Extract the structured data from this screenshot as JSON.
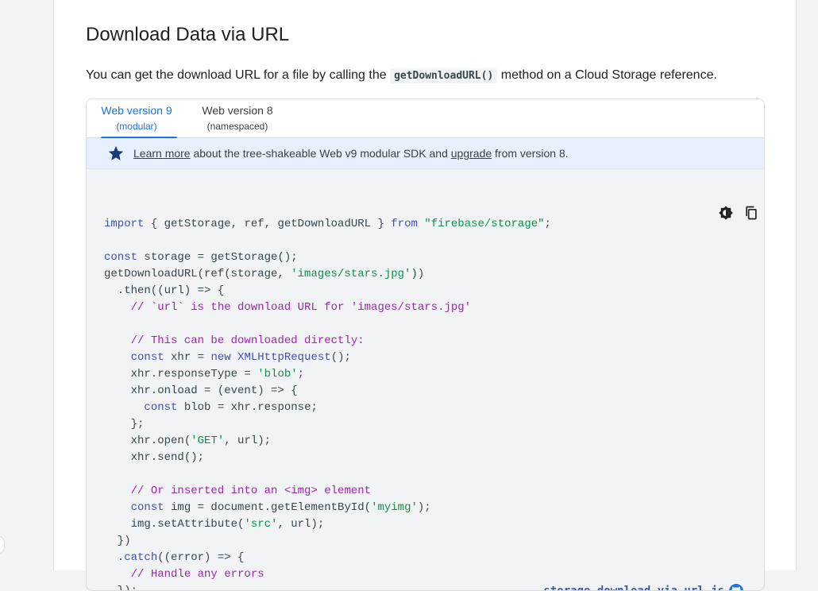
{
  "section": {
    "title": "Download Data via URL",
    "intro_before": "You can get the download URL for a file by calling the ",
    "intro_code": "getDownloadURL()",
    "intro_after": " method on a Cloud Storage reference."
  },
  "tabs": [
    {
      "label": "Web version 9",
      "sublabel": "(modular)",
      "active": true
    },
    {
      "label": "Web version 8",
      "sublabel": "(namespaced)",
      "active": false
    }
  ],
  "notice": {
    "icon": "star-icon",
    "link1": "Learn more",
    "text1": " about the tree-shakeable Web v9 modular SDK and ",
    "link2": "upgrade",
    "text2": " from version 8."
  },
  "code": {
    "toolbar": {
      "theme_icon": "dark-mode-toggle-icon",
      "copy_icon": "copy-icon"
    },
    "lines": [
      "import { getStorage, ref, getDownloadURL } from \"firebase/storage\";",
      "",
      "const storage = getStorage();",
      "getDownloadURL(ref(storage, 'images/stars.jpg'))",
      "  .then((url) => {",
      "    // `url` is the download URL for 'images/stars.jpg'",
      "",
      "    // This can be downloaded directly:",
      "    const xhr = new XMLHttpRequest();",
      "    xhr.responseType = 'blob';",
      "    xhr.onload = (event) => {",
      "      const blob = xhr.response;",
      "    };",
      "    xhr.open('GET', url);",
      "    xhr.send();",
      "",
      "    // Or inserted into an <img> element",
      "    const img = document.getElementById('myimg');",
      "    img.setAttribute('src', url);",
      "  })",
      "  .catch((error) => {",
      "    // Handle any errors",
      "  });"
    ],
    "filename": "storage_download_via_url.js",
    "filename_icon": "github-icon"
  }
}
